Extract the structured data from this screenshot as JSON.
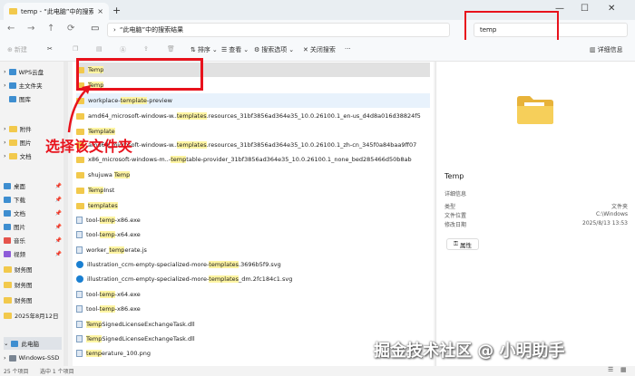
{
  "window": {
    "tab_title": "temp - “此电脑”中的搜索结果",
    "tab_close": "×",
    "tab_add": "+",
    "minimize": "—",
    "maximize": "☐",
    "close": "✕"
  },
  "addressbar": {
    "path": "“此电脑”中的搜索结果",
    "search_value": "temp"
  },
  "toolbar": {
    "new": "新建",
    "sort": "排序",
    "view": "查看",
    "search_options": "搜索选项",
    "close_search": "关闭搜索",
    "more": "···",
    "details": "详细信息"
  },
  "sidebar": {
    "items": [
      {
        "label": "WPS云盘",
        "icon": "cloud-icon"
      },
      {
        "label": "主文件夹",
        "icon": "home-icon"
      },
      {
        "label": "图库",
        "icon": "gallery-icon"
      },
      {
        "label": "附件",
        "icon": "folder-icon"
      },
      {
        "label": "图片",
        "icon": "folder-icon"
      },
      {
        "label": "文档",
        "icon": "folder-icon"
      },
      {
        "label": "桌面",
        "icon": "desktop-icon"
      },
      {
        "label": "下载",
        "icon": "download-icon"
      },
      {
        "label": "文档",
        "icon": "documents-icon"
      },
      {
        "label": "图片",
        "icon": "pictures-icon"
      },
      {
        "label": "音乐",
        "icon": "music-icon"
      },
      {
        "label": "视频",
        "icon": "video-icon"
      },
      {
        "label": "财务图",
        "icon": "folder-icon"
      },
      {
        "label": "财务图",
        "icon": "folder-icon"
      },
      {
        "label": "财务图",
        "icon": "folder-icon"
      },
      {
        "label": "2025年8月12日",
        "icon": "folder-icon"
      },
      {
        "label": "此电脑",
        "icon": "pc-icon"
      },
      {
        "label": "Windows-SSD",
        "icon": "drive-icon"
      }
    ]
  },
  "files": [
    {
      "pre": "",
      "hl": "Temp",
      "post": "",
      "icon": "folder"
    },
    {
      "pre": "",
      "hl": "Temp",
      "post": "",
      "icon": "folder"
    },
    {
      "pre": "workplace-",
      "hl": "template",
      "post": "-preview",
      "icon": "folder"
    },
    {
      "pre": "amd64_microsoft-windows-w..",
      "hl": "templates",
      "post": ".resources_31bf3856ad364e35_10.0.26100.1_en-us_d4d8a016d38824f5",
      "icon": "folder"
    },
    {
      "pre": "",
      "hl": "Template",
      "post": "",
      "icon": "folder"
    },
    {
      "pre": "amd64_microsoft-windows-w..",
      "hl": "templates",
      "post": ".resources_31bf3856ad364e35_10.0.26100.1_zh-cn_345f0a84baa9ff07",
      "icon": "folder"
    },
    {
      "pre": "x86_microsoft-windows-m..-",
      "hl": "temp",
      "post": "table-provider_31bf3856ad364e35_10.0.26100.1_none_bed285466d50b8ab",
      "icon": "folder"
    },
    {
      "pre": "shujuwa ",
      "hl": "Temp",
      "post": "",
      "icon": "folder"
    },
    {
      "pre": "",
      "hl": "Temp",
      "post": "Inst",
      "icon": "folder"
    },
    {
      "pre": "",
      "hl": "templates",
      "post": "",
      "icon": "folder"
    },
    {
      "pre": "tool-",
      "hl": "temp",
      "post": "-x86.exe",
      "icon": "file"
    },
    {
      "pre": "tool-",
      "hl": "temp",
      "post": "-x64.exe",
      "icon": "file"
    },
    {
      "pre": "worker_",
      "hl": "temp",
      "post": "erate.js",
      "icon": "file"
    },
    {
      "pre": "illustration_ccm-empty-specialized-more-",
      "hl": "templates",
      "post": ".3696b5f9.svg",
      "icon": "edge"
    },
    {
      "pre": "illustration_ccm-empty-specialized-more-",
      "hl": "templates",
      "post": "_dm.2fc184c1.svg",
      "icon": "edge"
    },
    {
      "pre": "tool-",
      "hl": "temp",
      "post": "-x64.exe",
      "icon": "file"
    },
    {
      "pre": "tool-",
      "hl": "temp",
      "post": "-x86.exe",
      "icon": "file"
    },
    {
      "pre": "",
      "hl": "Temp",
      "post": "SignedLicenseExchangeTask.dll",
      "icon": "file"
    },
    {
      "pre": "",
      "hl": "Temp",
      "post": "SignedLicenseExchangeTask.dll",
      "icon": "file"
    },
    {
      "pre": "",
      "hl": "temp",
      "post": "erature_100.png",
      "icon": "file"
    }
  ],
  "annotation": {
    "text": "选择该文件夹"
  },
  "details": {
    "name": "Temp",
    "section": "详细信息",
    "rows": [
      {
        "label": "类型",
        "value": "文件夹"
      },
      {
        "label": "文件位置",
        "value": "C:\\Windows"
      },
      {
        "label": "修改日期",
        "value": "2025/8/13 13:53"
      }
    ],
    "properties": "属性"
  },
  "statusbar": {
    "count": "25 个项目",
    "selected": "选中 1 个项目"
  },
  "watermark": "掘金技术社区 @ 小明助手",
  "colors": {
    "highlight": "#fff5a3",
    "annotation_red": "#e8121c",
    "folder": "#f2c94c"
  }
}
